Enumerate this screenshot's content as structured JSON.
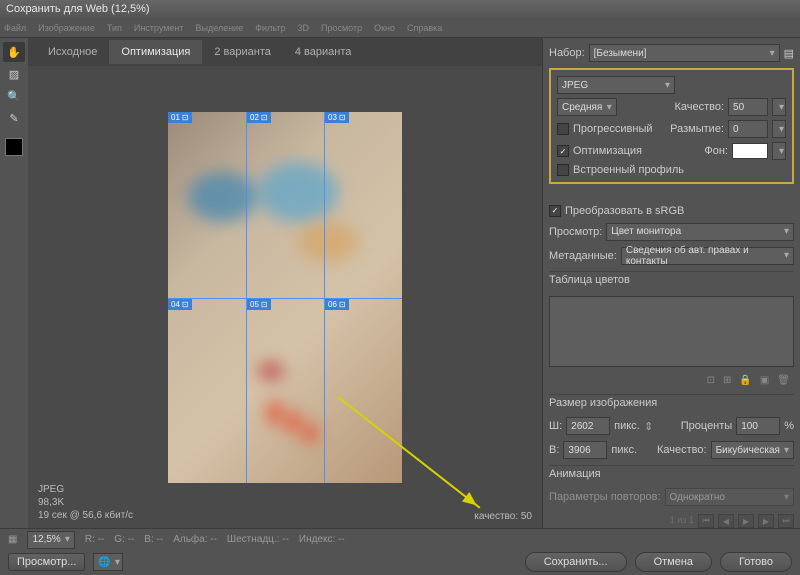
{
  "title": "Сохранить для Web (12,5%)",
  "menubar": [
    "Файл",
    "Изображение",
    "Тип",
    "Инструмент",
    "Выделение",
    "Фильтр",
    "3D",
    "Просмотр",
    "Окно",
    "Справка"
  ],
  "tabs": {
    "t1": "Исходное",
    "t2": "Оптимизация",
    "t3": "2 варианта",
    "t4": "4 варианта",
    "active": "t2"
  },
  "info": {
    "format": "JPEG",
    "size": "98,3K",
    "speed": "19 сек @ 56,6 кбит/с"
  },
  "quality_corner": "качество: 50",
  "preset": {
    "label": "Набор:",
    "value": "[Безымени]"
  },
  "format": {
    "value": "JPEG"
  },
  "qualityPreset": "Средняя",
  "quality": {
    "label": "Качество:",
    "value": "50"
  },
  "progressive": {
    "label": "Прогрессивный",
    "checked": false
  },
  "blur": {
    "label": "Размытие:",
    "value": "0"
  },
  "optimized": {
    "label": "Оптимизация",
    "checked": true
  },
  "matte": {
    "label": "Фон:"
  },
  "embedProfile": {
    "label": "Встроенный профиль",
    "checked": false
  },
  "srgb": {
    "label": "Преобразовать в sRGB",
    "checked": true
  },
  "preview": {
    "label": "Просмотр:",
    "value": "Цвет монитора"
  },
  "metadata": {
    "label": "Метаданные:",
    "value": "Сведения об авт. правах и контакты"
  },
  "colorTable": {
    "title": "Таблица цветов"
  },
  "imageSize": {
    "title": "Размер изображения",
    "w_label": "Ш:",
    "w": "2602",
    "h_label": "В:",
    "h": "3906",
    "unit": "пикс.",
    "percent_label": "Проценты",
    "percent": "100",
    "percent_unit": "%",
    "quality_label": "Качество:",
    "quality": "Бикубическая"
  },
  "animation": {
    "title": "Анимация",
    "repeat_label": "Параметры повторов:",
    "repeat": "Однократно",
    "frame": "1 из 1"
  },
  "footer": {
    "zoom": "12,5%",
    "r": "R: --",
    "g": "G: --",
    "b": "B: --",
    "alpha": "Альфа: --",
    "hex": "Шестнадц.: --",
    "index": "Индекс: --",
    "preview_btn": "Просмотр...",
    "save": "Сохранить...",
    "cancel": "Отмена",
    "done": "Готово"
  },
  "slices": [
    "01",
    "02",
    "03",
    "04",
    "05",
    "06"
  ],
  "slice_icon": "⊡"
}
